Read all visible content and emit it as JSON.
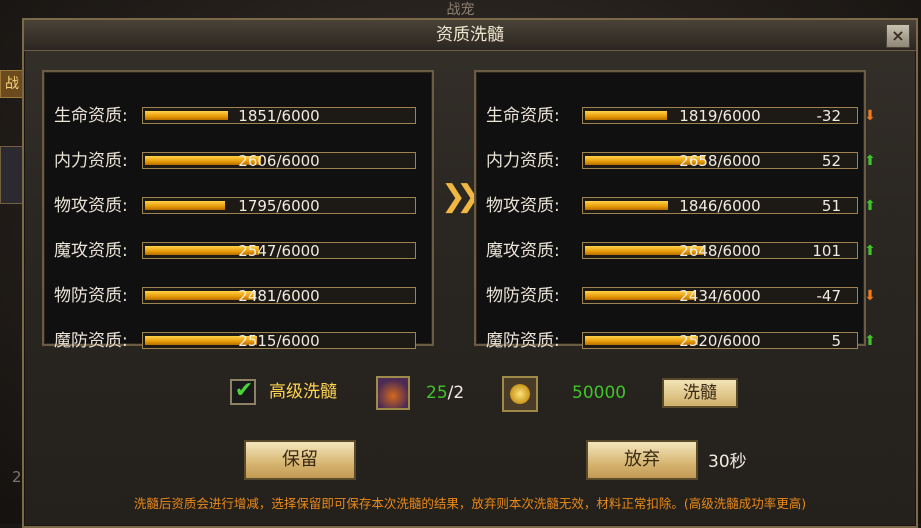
{
  "background": {
    "title": "战宠",
    "side_tab_label": "战",
    "side_number": "2"
  },
  "dialog": {
    "title": "资质洗髓",
    "close_label": "×"
  },
  "current": [
    {
      "label": "生命资质:",
      "value": "1851/6000",
      "fraction": 0.3085
    },
    {
      "label": "内力资质:",
      "value": "2606/6000",
      "fraction": 0.4343
    },
    {
      "label": "物攻资质:",
      "value": "1795/6000",
      "fraction": 0.2992
    },
    {
      "label": "魔攻资质:",
      "value": "2547/6000",
      "fraction": 0.4245
    },
    {
      "label": "物防资质:",
      "value": "2481/6000",
      "fraction": 0.4135
    },
    {
      "label": "魔防资质:",
      "value": "2515/6000",
      "fraction": 0.4192
    }
  ],
  "result": [
    {
      "label": "生命资质:",
      "value": "1819/6000",
      "fraction": 0.3032,
      "delta": "-32",
      "direction": "down"
    },
    {
      "label": "内力资质:",
      "value": "2658/6000",
      "fraction": 0.443,
      "delta": "52",
      "direction": "up"
    },
    {
      "label": "物攻资质:",
      "value": "1846/6000",
      "fraction": 0.3077,
      "delta": "51",
      "direction": "up"
    },
    {
      "label": "魔攻资质:",
      "value": "2648/6000",
      "fraction": 0.4413,
      "delta": "101",
      "direction": "up"
    },
    {
      "label": "物防资质:",
      "value": "2434/6000",
      "fraction": 0.4057,
      "delta": "-47",
      "direction": "down"
    },
    {
      "label": "魔防资质:",
      "value": "2520/6000",
      "fraction": 0.42,
      "delta": "5",
      "direction": "up"
    }
  ],
  "cost": {
    "advanced_checked": true,
    "advanced_label": "高级洗髓",
    "potion_have": "25",
    "potion_need": "/2",
    "coin_amount": "50000",
    "wash_button": "洗髓"
  },
  "actions": {
    "keep_button": "保留",
    "abandon_button": "放弃",
    "timer": "30秒"
  },
  "notice": "洗髓后资质会进行增减，选择保留即可保存本次洗髓的结果，放弃则本次洗髓无效，材料正常扣除。(高级洗髓成功率更高)",
  "colors": {
    "bar_fill": "#e79b08",
    "up_arrow": "#3fc52a",
    "down_arrow": "#f07a1c",
    "advanced_label": "#ffd452",
    "notice": "#e8891a"
  }
}
